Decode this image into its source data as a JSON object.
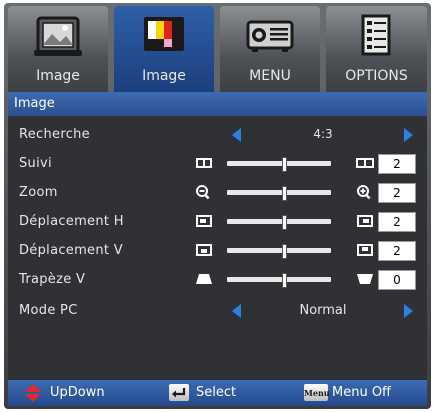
{
  "tabs": [
    {
      "label": "Image",
      "icon": "picture-frame-icon",
      "active": false
    },
    {
      "label": "Image",
      "icon": "color-bars-icon",
      "active": true
    },
    {
      "label": "MENU",
      "icon": "projector-icon",
      "active": false
    },
    {
      "label": "OPTIONS",
      "icon": "settings-sheet-icon",
      "active": false
    }
  ],
  "section_title": "Image",
  "rows": {
    "recherche": {
      "label": "Recherche",
      "value": "4:3"
    },
    "suivi": {
      "label": "Suivi",
      "value": "2"
    },
    "zoom": {
      "label": "Zoom",
      "value": "2"
    },
    "deplacement_h": {
      "label": "Déplacement H",
      "value": "2"
    },
    "deplacement_v": {
      "label": "Déplacement V",
      "value": "2"
    },
    "trapeze_v": {
      "label": "Trapèze V",
      "value": "0"
    },
    "mode_pc": {
      "label": "Mode PC",
      "value": "Normal"
    }
  },
  "footer": {
    "updown": "UpDown",
    "select": "Select",
    "menu_key": "Menu",
    "menu_off": "Menu Off"
  },
  "colors": {
    "accent": "#2f7fe6",
    "header": "#2a4f8f",
    "footer_arrow": "#e8262d"
  }
}
